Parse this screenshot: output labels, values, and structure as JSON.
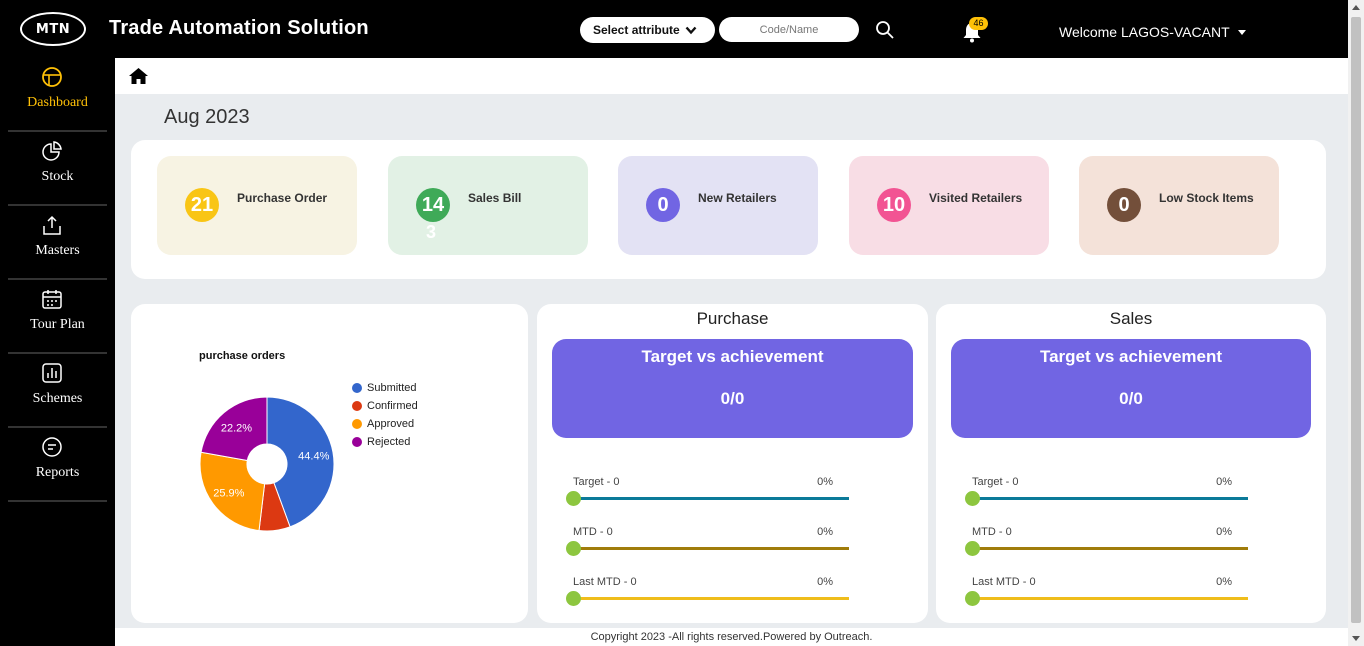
{
  "header": {
    "logo_text": "MTN",
    "app_title": "Trade Automation Solution",
    "select_attribute": "Select attribute",
    "search_placeholder": "Code/Name",
    "notification_count": "46",
    "welcome": "Welcome LAGOS-VACANT"
  },
  "sidebar": {
    "items": [
      {
        "label": "Dashboard",
        "icon": "dashboard-icon",
        "active": true
      },
      {
        "label": "Stock",
        "icon": "pie-chart-icon"
      },
      {
        "label": "Masters",
        "icon": "upload-icon"
      },
      {
        "label": "Tour Plan",
        "icon": "calendar-icon"
      },
      {
        "label": "Schemes",
        "icon": "bar-chart-icon"
      },
      {
        "label": "Reports",
        "icon": "report-icon"
      }
    ]
  },
  "period": "Aug 2023",
  "tiles": [
    {
      "value": "21",
      "overflow": "",
      "label": "Purchase Order",
      "bg": "#f7f3e3",
      "circle": "#f9c515"
    },
    {
      "value": "14",
      "overflow": "3",
      "label": "Sales Bill",
      "bg": "#e2f1e5",
      "circle": "#3faa58"
    },
    {
      "value": "0",
      "overflow": "",
      "label": "New Retailers",
      "bg": "#e3e2f4",
      "circle": "#7165e3"
    },
    {
      "value": "10",
      "overflow": "",
      "label": "Visited Retailers",
      "bg": "#f8dde5",
      "circle": "#f25493"
    },
    {
      "value": "0",
      "overflow": "",
      "label": "Low Stock Items",
      "bg": "#f4e2d9",
      "circle": "#734f3a"
    }
  ],
  "chart_data": {
    "type": "pie",
    "title": "purchase orders",
    "donut": true,
    "legend_position": "right",
    "slices": [
      {
        "label": "Submitted",
        "value": 44.4,
        "color": "#3366cc",
        "data_label": "44.4%"
      },
      {
        "label": "Confirmed",
        "value": 7.5,
        "color": "#dc3912",
        "data_label": ""
      },
      {
        "label": "Approved",
        "value": 25.9,
        "color": "#ff9900",
        "data_label": "25.9%"
      },
      {
        "label": "Rejected",
        "value": 22.2,
        "color": "#990099",
        "data_label": "22.2%"
      }
    ]
  },
  "purchase": {
    "title": "Purchase",
    "tva_heading": "Target vs achievement",
    "tva_value": "0/0",
    "meters": [
      {
        "label": "Target - 0",
        "percent": "0%",
        "value": 0,
        "color": "#0b7a99"
      },
      {
        "label": "MTD - 0",
        "percent": "0%",
        "value": 0,
        "color": "#a07c0a"
      },
      {
        "label": "Last MTD - 0",
        "percent": "0%",
        "value": 0,
        "color": "#efbd1b"
      }
    ]
  },
  "sales": {
    "title": "Sales",
    "tva_heading": "Target vs achievement",
    "tva_value": "0/0",
    "meters": [
      {
        "label": "Target - 0",
        "percent": "0%",
        "value": 0,
        "color": "#0b7a99"
      },
      {
        "label": "MTD - 0",
        "percent": "0%",
        "value": 0,
        "color": "#a07c0a"
      },
      {
        "label": "Last MTD - 0",
        "percent": "0%",
        "value": 0,
        "color": "#efbd1b"
      }
    ]
  },
  "footer": "Copyright 2023  -All rights reserved.Powered by Outreach."
}
